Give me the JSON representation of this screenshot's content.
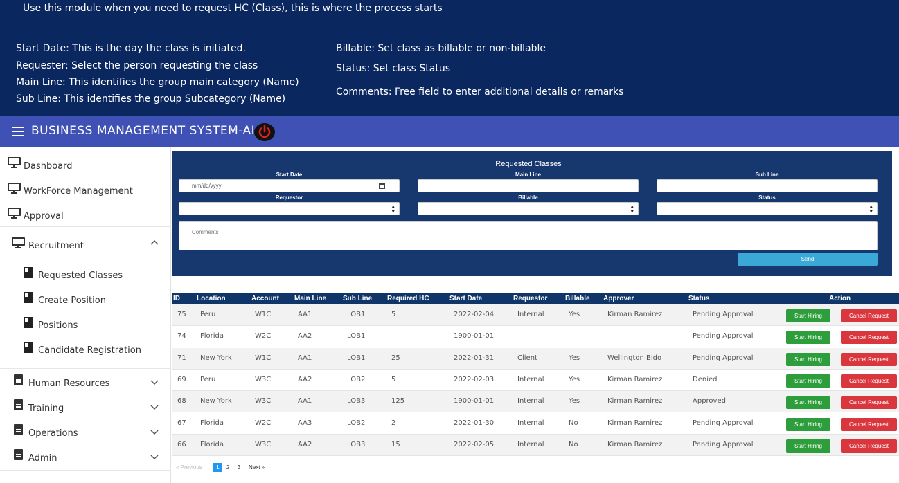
{
  "banner": {
    "intro": "Use this module when you need to request HC (Class), this is where the process starts",
    "left_notes": [
      "Start Date: This is the day the class is initiated.",
      "Requester: Select the person requesting the class",
      "Main Line: This identifies the group main category (Name)",
      "Sub Line: This identifies the group Subcategory (Name)"
    ],
    "right_notes": [
      "Billable: Set class as billable or non-billable",
      "Status: Set class Status",
      "Comments:  Free field to enter additional details or remarks"
    ]
  },
  "appbar": {
    "title": "BUSINESS MANAGEMENT SYSTEM-AI",
    "menu_icon": "hamburger-menu-icon",
    "power_icon": "power-icon",
    "power_color": "#e02020"
  },
  "sidebar": {
    "items": [
      {
        "label": "Dashboard",
        "icon": "monitor-icon"
      },
      {
        "label": "WorkForce Management",
        "icon": "monitor-icon"
      },
      {
        "label": "Approval",
        "icon": "monitor-icon"
      },
      {
        "label": "Recruitment",
        "icon": "monitor-icon",
        "expanded": true
      },
      {
        "label": "Requested Classes",
        "icon": "book-icon"
      },
      {
        "label": "Create Position",
        "icon": "book-icon"
      },
      {
        "label": "Positions",
        "icon": "book-icon"
      },
      {
        "label": "Candidate Registration",
        "icon": "book-icon"
      },
      {
        "label": "Human Resources",
        "icon": "document-icon"
      },
      {
        "label": "Training",
        "icon": "document-icon"
      },
      {
        "label": "Operations",
        "icon": "document-icon"
      },
      {
        "label": "Admin",
        "icon": "document-icon"
      }
    ]
  },
  "form": {
    "title": "Requested Classes",
    "start_date_label": "Start Date",
    "start_date_placeholder": "mm/dd/yyyy",
    "main_line_label": "Main Line",
    "main_line_value": "",
    "sub_line_label": "Sub Line",
    "sub_line_value": "",
    "requestor_label": "Requestor",
    "requestor_value": "",
    "billable_label": "Billable",
    "billable_value": "",
    "status_label": "Status",
    "status_value": "",
    "comments_placeholder": "Comments",
    "send_label": "Send"
  },
  "table": {
    "columns": [
      "ID",
      "Location",
      "Account",
      "Main Line",
      "Sub Line",
      "Required HC",
      "Start Date",
      "Requestor",
      "Billable",
      "Approver",
      "Status",
      "Action"
    ],
    "rows": [
      {
        "id": "75",
        "location": "Peru",
        "account": "W1C",
        "main_line": "AA1",
        "sub_line": "LOB1",
        "required_hc": "5",
        "start_date": "2022-02-04",
        "requestor": "Internal",
        "billable": "Yes",
        "approver": "Kirman Ramirez",
        "status": "Pending Approval"
      },
      {
        "id": "74",
        "location": "Florida",
        "account": "W2C",
        "main_line": "AA2",
        "sub_line": "LOB1",
        "required_hc": "",
        "start_date": "1900-01-01",
        "requestor": "",
        "billable": "",
        "approver": "",
        "status": "Pending Approval"
      },
      {
        "id": "71",
        "location": "New York",
        "account": "W1C",
        "main_line": "AA1",
        "sub_line": "LOB1",
        "required_hc": "25",
        "start_date": "2022-01-31",
        "requestor": "Client",
        "billable": "Yes",
        "approver": "Wellington Bido",
        "status": "Pending Approval"
      },
      {
        "id": "69",
        "location": "Peru",
        "account": "W3C",
        "main_line": "AA2",
        "sub_line": "LOB2",
        "required_hc": "5",
        "start_date": "2022-02-03",
        "requestor": "Internal",
        "billable": "Yes",
        "approver": "Kirman Ramirez",
        "status": "Denied"
      },
      {
        "id": "68",
        "location": "New York",
        "account": "W3C",
        "main_line": "AA1",
        "sub_line": "LOB3",
        "required_hc": "125",
        "start_date": "1900-01-01",
        "requestor": "Internal",
        "billable": "Yes",
        "approver": "Kirman Ramirez",
        "status": "Approved"
      },
      {
        "id": "67",
        "location": "Florida",
        "account": "W2C",
        "main_line": "AA3",
        "sub_line": "LOB2",
        "required_hc": "2",
        "start_date": "2022-01-30",
        "requestor": "Internal",
        "billable": "No",
        "approver": "Kirman Ramirez",
        "status": "Pending Approval"
      },
      {
        "id": "66",
        "location": "Florida",
        "account": "W3C",
        "main_line": "AA2",
        "sub_line": "LOB3",
        "required_hc": "15",
        "start_date": "2022-02-05",
        "requestor": "Internal",
        "billable": "No",
        "approver": "Kirman Ramirez",
        "status": "Pending Approval"
      }
    ],
    "start_hiring_label": "Start Hiring",
    "cancel_request_label": "Cancel Request"
  },
  "pagination": {
    "previous": "« Previous",
    "pages": [
      "1",
      "2",
      "3"
    ],
    "current": "1",
    "next": "Next »"
  },
  "colors": {
    "banner_bg": "#0b2760",
    "appbar_bg": "#3f51b5",
    "panel_bg": "#16386f",
    "table_header_bg": "#0f3569",
    "start_hiring": "#2e9e3c",
    "cancel_request": "#d9363e",
    "send": "#3ba9d8"
  }
}
